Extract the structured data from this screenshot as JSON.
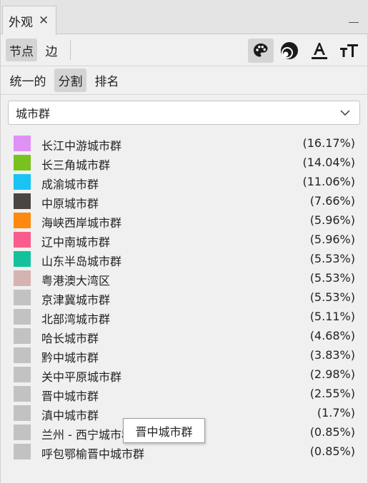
{
  "window": {
    "tab_title": "外观",
    "close_glyph": "✕"
  },
  "toolbar": {
    "nodes_label": "节点",
    "edges_label": "边",
    "icons": [
      "palette-icon",
      "size-icon",
      "label-color-icon",
      "label-size-icon"
    ]
  },
  "modes": {
    "unique_label": "统一的",
    "partition_label": "分割",
    "ranking_label": "排名"
  },
  "attribute_select": {
    "value": "城市群"
  },
  "partition": {
    "items": [
      {
        "label": "长江中游城市群",
        "percent": "(16.17%)",
        "color": "#e091f5"
      },
      {
        "label": "长三角城市群",
        "percent": "(14.04%)",
        "color": "#79c21e"
      },
      {
        "label": "成渝城市群",
        "percent": "(11.06%)",
        "color": "#19c4f4"
      },
      {
        "label": "中原城市群",
        "percent": "(7.66%)",
        "color": "#4a4540"
      },
      {
        "label": "海峡西岸城市群",
        "percent": "(5.96%)",
        "color": "#fd8a0e"
      },
      {
        "label": "辽中南城市群",
        "percent": "(5.96%)",
        "color": "#fb5c8d"
      },
      {
        "label": "山东半岛城市群",
        "percent": "(5.53%)",
        "color": "#13c29c"
      },
      {
        "label": "粤港澳大湾区",
        "percent": "(5.53%)",
        "color": "#d5b3b0"
      },
      {
        "label": "京津冀城市群",
        "percent": "(5.53%)",
        "color": "#c2c2c2"
      },
      {
        "label": "北部湾城市群",
        "percent": "(5.11%)",
        "color": "#c2c2c2"
      },
      {
        "label": "哈长城市群",
        "percent": "(4.68%)",
        "color": "#c2c2c2"
      },
      {
        "label": "黔中城市群",
        "percent": "(3.83%)",
        "color": "#c2c2c2"
      },
      {
        "label": "关中平原城市群",
        "percent": "(2.98%)",
        "color": "#c2c2c2"
      },
      {
        "label": "晋中城市群",
        "percent": "(2.55%)",
        "color": "#c2c2c2"
      },
      {
        "label": "滇中城市群",
        "percent": "(1.7%)",
        "color": "#c2c2c2"
      },
      {
        "label": "兰州 - 西宁城市群",
        "percent": "(0.85%)",
        "color": "#c2c2c2"
      },
      {
        "label": "呼包鄂榆晋中城市群",
        "percent": "(0.85%)",
        "color": "#c2c2c2"
      }
    ]
  },
  "tooltip": {
    "text": "晋中城市群"
  }
}
